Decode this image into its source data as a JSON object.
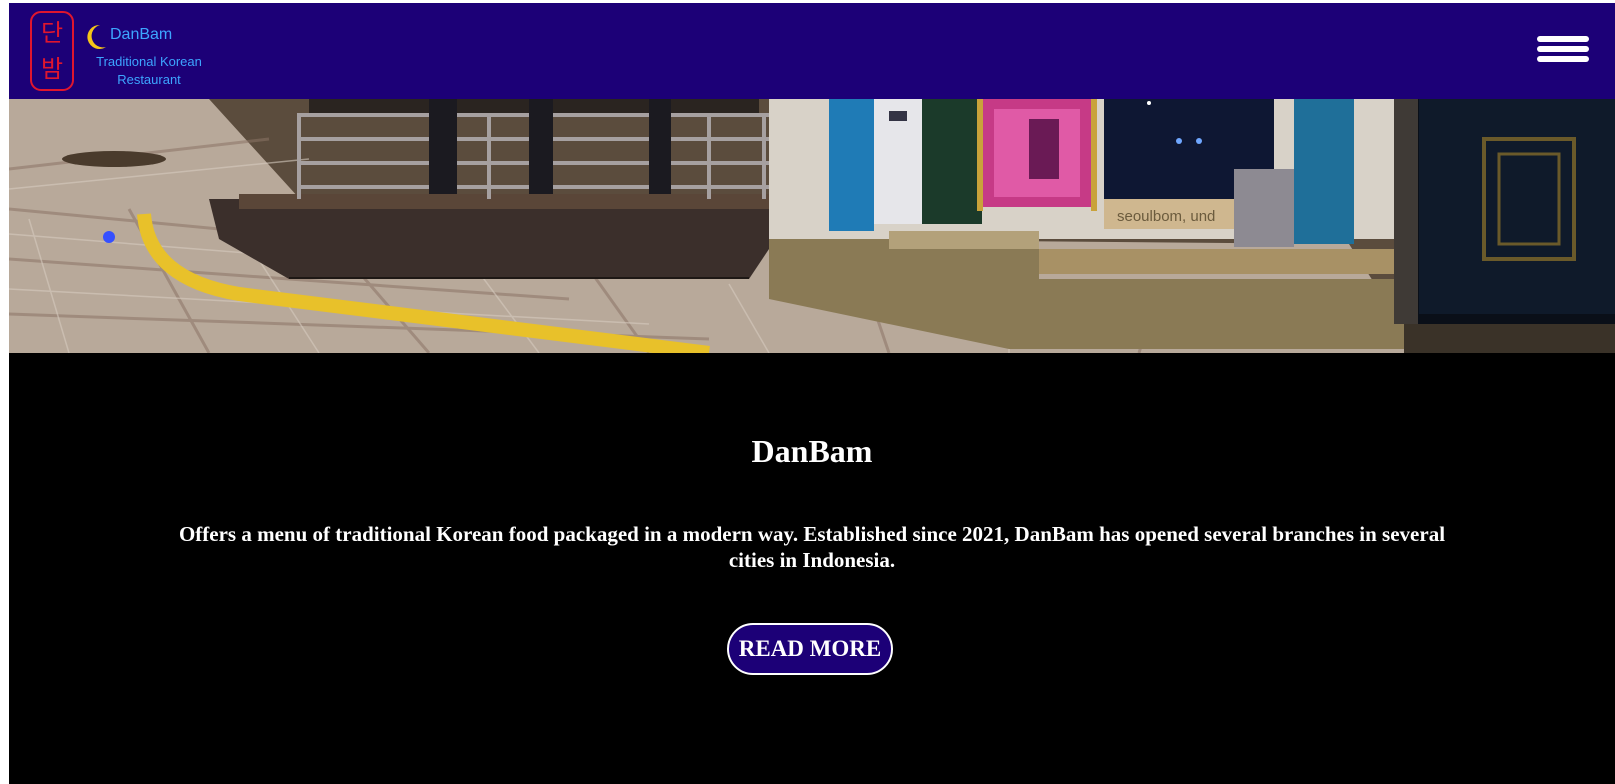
{
  "colors": {
    "navbar_bg": "#1c0077",
    "page_bg": "#000000",
    "logo_red": "#e0162e",
    "logo_blue": "#3da5ff",
    "moon_yellow": "#f5c518",
    "button_bg": "#1c0077",
    "text": "#ffffff"
  },
  "header": {
    "logo": {
      "hangul_top": "단",
      "hangul_bottom": "밤",
      "brand_name": "DanBam",
      "tagline": "Traditional Korean Restaurant",
      "moon_icon": "crescent-moon-icon"
    },
    "menu_icon": "hamburger-menu-icon"
  },
  "hero": {
    "image": "restaurant-storefront-photo",
    "sign_text": "seoulbom, und"
  },
  "main": {
    "title": "DanBam",
    "description": "Offers a menu of traditional Korean food packaged in a modern way. Established since 2021, DanBam has opened several branches in several cities in Indonesia.",
    "read_more_label": "READ MORE"
  }
}
